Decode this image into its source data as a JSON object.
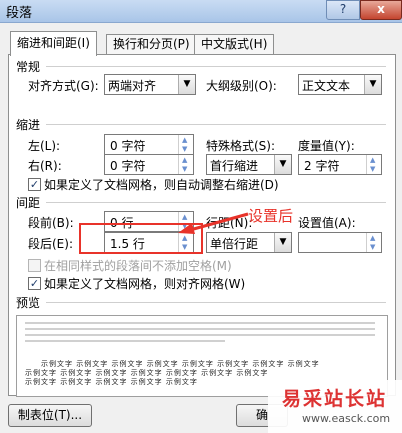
{
  "window": {
    "title": "段落",
    "help_label": "?",
    "close_label": "x"
  },
  "tabs": [
    {
      "label": "缩进和间距(I)"
    },
    {
      "label": "换行和分页(P)"
    },
    {
      "label": "中文版式(H)"
    }
  ],
  "general": {
    "heading": "常规",
    "alignment_label": "对齐方式(G):",
    "alignment_value": "两端对齐",
    "outline_label": "大纲级别(O):",
    "outline_value": "正文文本"
  },
  "indent": {
    "heading": "缩进",
    "left_label": "左(L):",
    "left_value": "0 字符",
    "right_label": "右(R):",
    "right_value": "0 字符",
    "special_label": "特殊格式(S):",
    "special_value": "首行缩进",
    "measure_label": "度量值(Y):",
    "measure_value": "2 字符",
    "grid_check_label": "如果定义了文档网格，则自动调整右缩进(D)",
    "grid_checked": true
  },
  "spacing": {
    "heading": "间距",
    "before_label": "段前(B):",
    "before_value": "0 行",
    "after_label": "段后(E):",
    "after_value": "1.5 行",
    "line_label": "行距(N):",
    "line_value": "单倍行距",
    "setting_label": "设置值(A):",
    "no_space_label": "在相同样式的段落间不添加空格(M)",
    "no_space_checked": false,
    "snap_label": "如果定义了文档网格，则对齐网格(W)",
    "snap_checked": true
  },
  "preview": {
    "heading": "预览",
    "sample_lines": [
      "示例文字 示例文字 示例文字 示例文字 示例文字 示例文字 示例文字 示例文字",
      "示例文字 示例文字 示例文字 示例文字 示例文字 示例文字 示例文字",
      "示例文字 示例文字 示例文字 示例文字 示例文字"
    ]
  },
  "buttons": {
    "tabs_label": "制表位(T)...",
    "ok_label": "确"
  },
  "annotation": {
    "text": "设置后",
    "color": "#e8332a"
  },
  "watermark": {
    "title": "易采站长站",
    "url": "www.easck.com"
  }
}
